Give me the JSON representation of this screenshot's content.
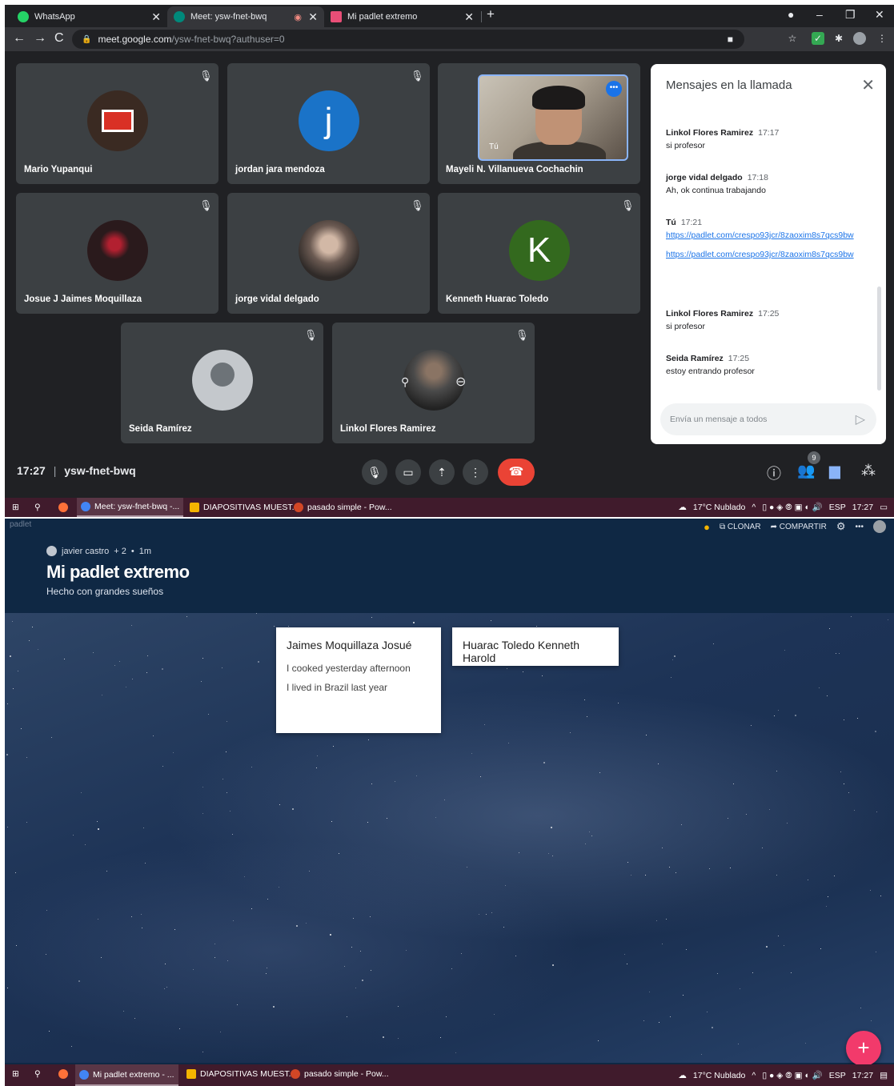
{
  "meet": {
    "tabs": [
      {
        "label": "WhatsApp",
        "color": "#25d366"
      },
      {
        "label": "Meet: ysw-fnet-bwq",
        "color": "#00897b"
      },
      {
        "label": "Mi padlet extremo",
        "color": "#e94e77"
      }
    ],
    "url": {
      "host": "meet.google.com",
      "path": "/ysw-fnet-bwq?authuser=0"
    },
    "participants": [
      {
        "name": "Mario Yupanqui",
        "avatar_text": "",
        "avatar_color": "#3a2a22"
      },
      {
        "name": "jordan jara mendoza",
        "avatar_text": "j",
        "avatar_color": "#1a73c8"
      },
      {
        "name": "Mayeli N. Villanueva Cochachin",
        "self_label": "Tú"
      },
      {
        "name": "Josue J Jaimes Moquillaza",
        "avatar_text": "",
        "avatar_color": "#2a1a1c"
      },
      {
        "name": "jorge vidal delgado",
        "avatar_text": "",
        "avatar_color": "#6b5a52"
      },
      {
        "name": "Kenneth Huarac Toledo",
        "avatar_text": "K",
        "avatar_color": "#33691e"
      },
      {
        "name": "Seida Ramírez",
        "avatar_text": "",
        "avatar_color": "#c4c8cc"
      },
      {
        "name": "Linkol Flores Ramirez",
        "avatar_text": "",
        "avatar_color": "#4a4a4a"
      }
    ],
    "chat": {
      "title": "Mensajes en la llamada",
      "messages": [
        {
          "sender": "Linkol Flores Ramirez",
          "time": "17:17",
          "text": "si profesor"
        },
        {
          "sender": "jorge vidal delgado",
          "time": "17:18",
          "text": "Ah, ok continua trabajando"
        },
        {
          "sender": "Tú",
          "time": "17:21",
          "links": [
            "https://padlet.com/crespo93jcr/8zaoxim8s7qcs9bw",
            "https://padlet.com/crespo93jcr/8zaoxim8s7qcs9bw"
          ]
        },
        {
          "sender": "Linkol Flores Ramirez",
          "time": "17:25",
          "text": "si profesor"
        },
        {
          "sender": "Seida Ramírez",
          "time": "17:25",
          "text": "estoy entrando profesor"
        }
      ],
      "input_placeholder": "Envía un mensaje a todos"
    },
    "time": "17:27",
    "meeting_code": "ysw-fnet-bwq",
    "participant_count": "9"
  },
  "taskbar_top": {
    "items": [
      "Meet: ysw-fnet-bwq -...",
      "DIAPOSITIVAS MUEST...",
      "pasado simple - Pow..."
    ],
    "weather": "17°C  Nublado",
    "lang": "ESP",
    "clock": "17:27"
  },
  "padlet": {
    "logo": "padlet",
    "author": "javier castro",
    "contributors": "+ 2",
    "age": "1m",
    "title": "Mi padlet extremo",
    "subtitle": "Hecho con grandes sueños",
    "actions": {
      "clone": "CLONAR",
      "share": "COMPARTIR"
    },
    "posts": [
      {
        "title": "Jaimes Moquillaza Josué",
        "lines": [
          "I cooked yesterday afternoon",
          "I lived in Brazil last year"
        ]
      },
      {
        "title": "Huarac Toledo Kenneth Harold",
        "lines": []
      }
    ],
    "fab": "+"
  },
  "taskbar_bottom": {
    "items": [
      "Mi padlet extremo - ...",
      "DIAPOSITIVAS MUEST...",
      "pasado simple - Pow..."
    ],
    "weather": "17°C  Nublado",
    "lang": "ESP",
    "clock": "17:27"
  }
}
